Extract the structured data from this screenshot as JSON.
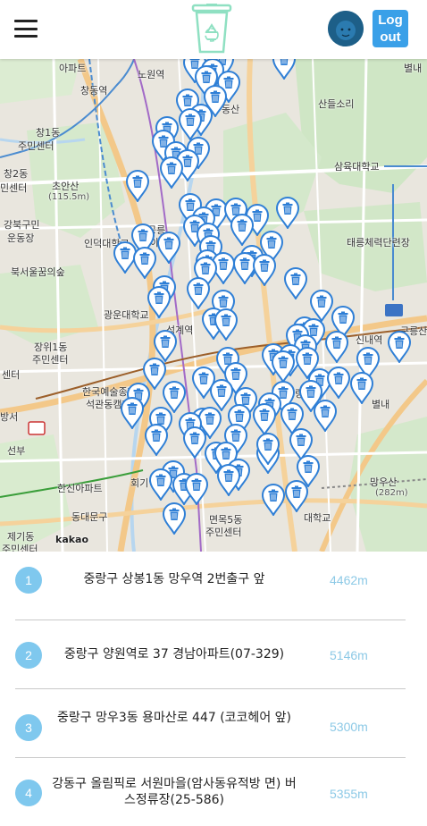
{
  "header": {
    "menu_icon": "hamburger-menu-icon",
    "logo_icon": "recycle-trash-bin-icon",
    "avatar_icon": "user-avatar-icon",
    "logout_label_1": "Log",
    "logout_label_2": "out",
    "logout_color": "#3aa0e8"
  },
  "map": {
    "pin_icon": "trash-bin-pin-icon",
    "pin_color": "#2f7fd6",
    "attribution": "kakao",
    "scale_label": "",
    "labels": {
      "l1": "아파트",
      "l2": "노원역",
      "l3": "창동역",
      "l4": "산들소리",
      "l5": "별내",
      "l6": "창1동",
      "l7": "주민센터",
      "l8": "동산",
      "l9": "삼육대학교",
      "l10": "창2동",
      "l11": "민센터",
      "l12": "초안산",
      "l13": "(115.5m)",
      "l14": "강북구민",
      "l15": "운동장",
      "l16": "인덕대학교",
      "l17": "공릉",
      "l18": "아파트",
      "l19": "태릉체력단련장",
      "l20": "북서울꿈의숲",
      "l21": "광운대학교",
      "l22": "석계역",
      "l23": "신내역",
      "l24": "구릉산",
      "l25": "장위1동",
      "l26": "주민센터",
      "l27": "한국예술종합",
      "l28": "석관동캠퍼",
      "l29": "별내",
      "l30": "중랑",
      "l31": "방서",
      "l32": "회기역",
      "l33": "망우산",
      "l34": "(282m)",
      "l35": "한신아파트",
      "l36": "동대문구",
      "l37": "면목5동",
      "l38": "주민센터",
      "l39": "제기동",
      "l40": "주민센터",
      "l41": "대학교",
      "l42": "센터",
      "l43": "선부"
    }
  },
  "list": {
    "items": [
      {
        "num": "1",
        "addr": "중랑구 상봉1동 망우역 2번출구 앞",
        "dist": "4462m"
      },
      {
        "num": "2",
        "addr": "중랑구 양원역로 37 경남아파트(07-329)",
        "dist": "5146m"
      },
      {
        "num": "3",
        "addr": "중랑구 망우3동 용마산로 447 (코코헤어 앞)",
        "dist": "5300m"
      },
      {
        "num": "4",
        "addr": "강동구 올림픽로 서원마을(암사동유적방 면) 버스정류장(25-586)",
        "dist": "5355m"
      }
    ]
  }
}
